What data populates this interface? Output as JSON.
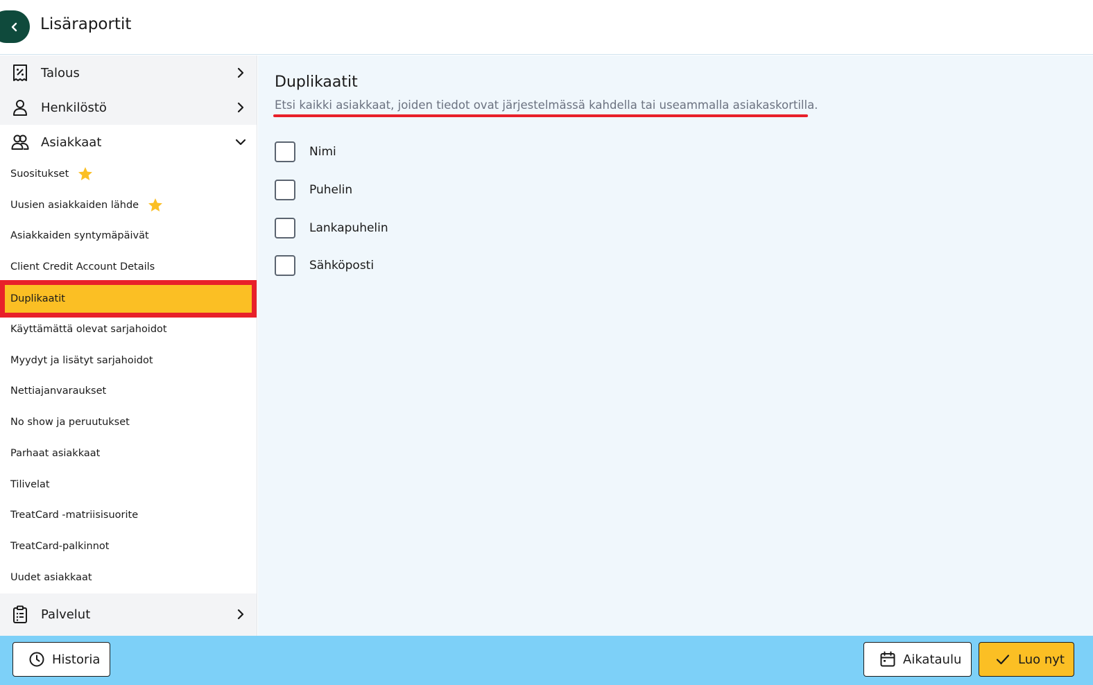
{
  "header": {
    "title": "Lisäraportit",
    "back_icon": "chevron-left-icon"
  },
  "sidebar": {
    "categories": [
      {
        "label": "Talous",
        "icon": "receipt-percent-icon",
        "expanded": false
      },
      {
        "label": "Henkilöstö",
        "icon": "user-icon",
        "expanded": false
      },
      {
        "label": "Asiakkaat",
        "icon": "users-icon",
        "expanded": true
      },
      {
        "label": "Palvelut",
        "icon": "clipboard-list-icon",
        "expanded": false
      }
    ],
    "items": [
      {
        "label": "Suositukset",
        "starred": true
      },
      {
        "label": "Uusien asiakkaiden lähde",
        "starred": true
      },
      {
        "label": "Asiakkaiden syntymäpäivät",
        "starred": false
      },
      {
        "label": "Client Credit Account Details",
        "starred": false
      },
      {
        "label": "Duplikaatit",
        "starred": false,
        "active": true
      },
      {
        "label": "Käyttämättä olevat sarjahoidot",
        "starred": false
      },
      {
        "label": "Myydyt ja lisätyt sarjahoidot",
        "starred": false
      },
      {
        "label": "Nettiajanvaraukset",
        "starred": false
      },
      {
        "label": "No show ja peruutukset",
        "starred": false
      },
      {
        "label": "Parhaat asiakkaat",
        "starred": false
      },
      {
        "label": "Tilivelat",
        "starred": false
      },
      {
        "label": "TreatCard -matriisisuorite",
        "starred": false
      },
      {
        "label": "TreatCard-palkinnot",
        "starred": false
      },
      {
        "label": "Uudet asiakkaat",
        "starred": false
      }
    ]
  },
  "main": {
    "title": "Duplikaatit",
    "description": "Etsi kaikki asiakkaat, joiden tiedot ovat järjestelmässä kahdella tai useammalla asiakaskortilla.",
    "options": [
      {
        "label": "Nimi",
        "checked": false
      },
      {
        "label": "Puhelin",
        "checked": false
      },
      {
        "label": "Lankapuhelin",
        "checked": false
      },
      {
        "label": "Sähköposti",
        "checked": false
      }
    ]
  },
  "footer": {
    "history_label": "Historia",
    "schedule_label": "Aikataulu",
    "create_label": "Luo nyt"
  },
  "colors": {
    "accent": "#fbbf24",
    "footer_bg": "#7dd0f8",
    "back_button": "#0f4a3c",
    "highlight": "#e8202a",
    "main_bg": "#f0f7fc"
  }
}
